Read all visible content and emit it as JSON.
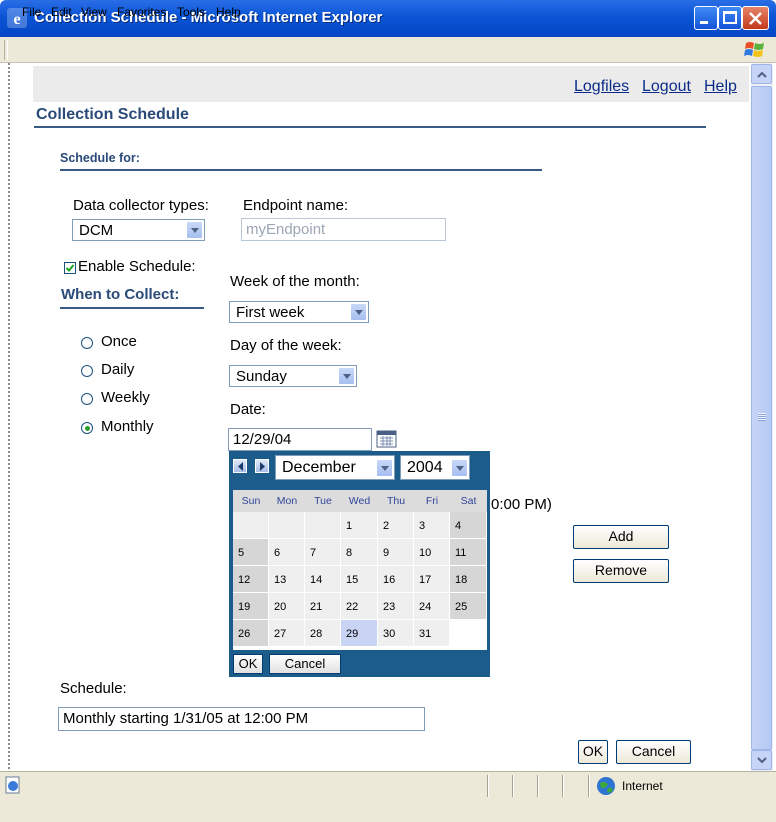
{
  "window": {
    "title": "Collection Schedule - Microsoft Internet Explorer"
  },
  "menu": [
    "File",
    "Edit",
    "View",
    "Favorites",
    "Tools",
    "Help"
  ],
  "toplinks": {
    "logfiles": "Logfiles",
    "logout": "Logout",
    "help": "Help"
  },
  "page": {
    "title": "Collection Schedule",
    "schedule_for": "Schedule for:"
  },
  "form": {
    "collector_label": "Data collector types:",
    "collector_value": "DCM",
    "endpoint_label": "Endpoint name:",
    "endpoint_value": "myEndpoint",
    "enable_label": "Enable Schedule:",
    "enable_checked": true,
    "when_label": "When to Collect:",
    "freq": [
      "Once",
      "Daily",
      "Weekly",
      "Monthly"
    ],
    "freq_selected": "Monthly",
    "week_label": "Week of the month:",
    "week_value": "First week",
    "day_label": "Day of the week:",
    "day_value": "Sunday",
    "date_label": "Date:",
    "date_value": "12/29/04",
    "time_fragment": "0:00 PM)",
    "add_label": "Add",
    "remove_label": "Remove",
    "schedule_label": "Schedule:",
    "schedule_value": "Monthly starting 1/31/05 at 12:00 PM",
    "ok_label": "OK",
    "cancel_label": "Cancel"
  },
  "calendar": {
    "month": "December",
    "year": "2004",
    "weekdays": [
      "Sun",
      "Mon",
      "Tue",
      "Wed",
      "Thu",
      "Fri",
      "Sat"
    ],
    "weeks": [
      [
        "",
        "",
        "",
        "1",
        "2",
        "3",
        "4"
      ],
      [
        "5",
        "6",
        "7",
        "8",
        "9",
        "10",
        "11"
      ],
      [
        "12",
        "13",
        "14",
        "15",
        "16",
        "17",
        "18"
      ],
      [
        "19",
        "20",
        "21",
        "22",
        "23",
        "24",
        "25"
      ],
      [
        "26",
        "27",
        "28",
        "29",
        "30",
        "31",
        ""
      ]
    ],
    "selected_day": "29",
    "ok_label": "OK",
    "cancel_label": "Cancel"
  },
  "status": {
    "zone": "Internet"
  },
  "colors": {
    "titlebar": "#0a55d6",
    "link": "#0b2c8a",
    "heading": "#2a4a78",
    "calendar_frame": "#1b5c8b",
    "selected_day": "#c9d4f5"
  }
}
